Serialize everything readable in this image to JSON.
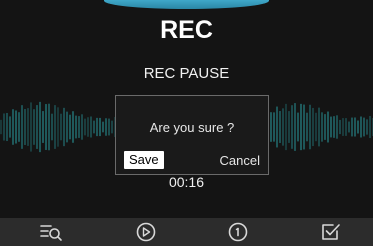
{
  "header": {
    "title": "REC"
  },
  "recording": {
    "status": "REC PAUSE",
    "elapsed": "00:16"
  },
  "dialog": {
    "message": "Are you sure ?",
    "save_label": "Save",
    "cancel_label": "Cancel"
  },
  "bottom_nav": {
    "items": [
      {
        "icon": "list-search-icon"
      },
      {
        "icon": "play-icon"
      },
      {
        "icon": "info-icon"
      },
      {
        "icon": "check-box-icon"
      }
    ]
  },
  "colors": {
    "background": "#141414",
    "accent_tab": "#3fa8c9",
    "waveform": "#1f5a5c",
    "bottom_bar": "#2c2c2c"
  }
}
